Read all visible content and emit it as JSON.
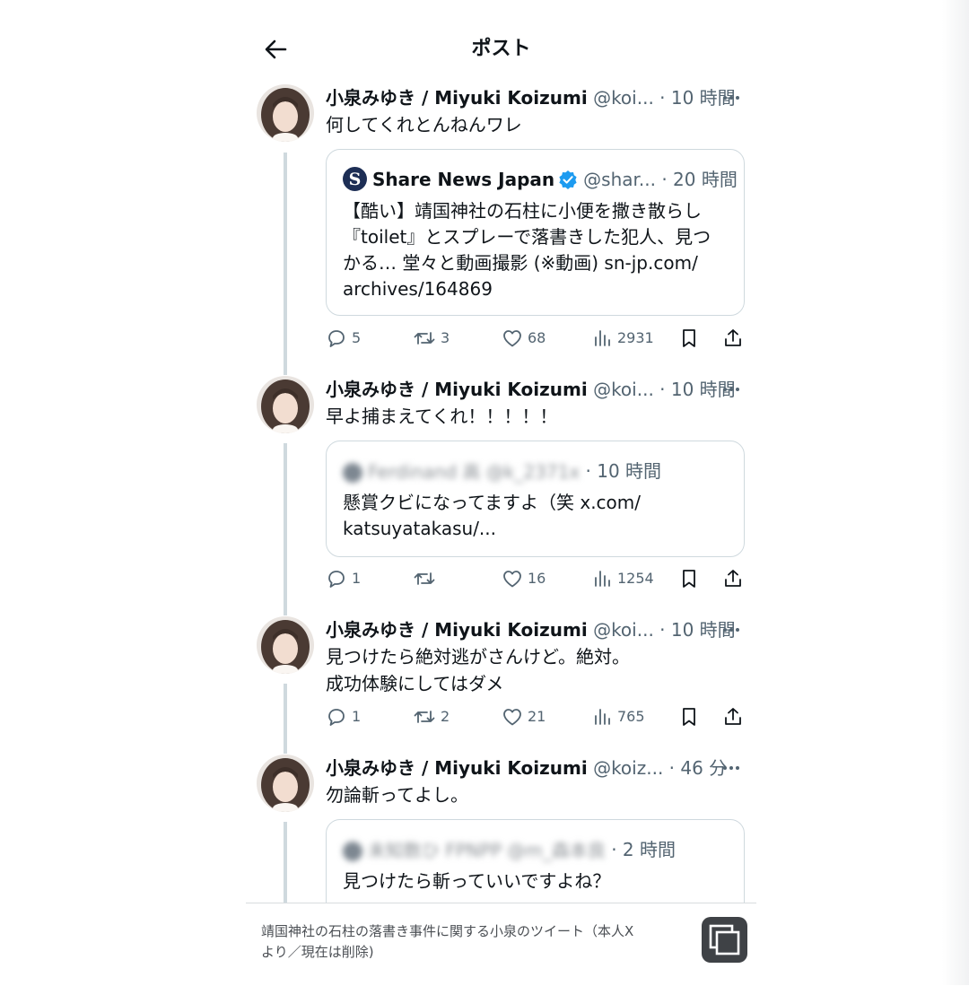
{
  "header": {
    "title": "ポスト"
  },
  "posts": [
    {
      "author": "小泉みゆき / Miyuki Koizumi",
      "handle": "@koi...",
      "time": "· 10 時間",
      "text": "何してくれとんねんワレ",
      "quote": {
        "author": "Share News Japan",
        "handle": "@shar...",
        "time": "· 20 時間",
        "text": "【酷い】靖国神社の石柱に小便を撒き散らし\n『toilet』とスプレーで落書きした犯人、見つ\nかる… 堂々と動画撮影 (※動画) sn-jp.com/\narchives/164869"
      },
      "stats": {
        "replies": "5",
        "reposts": "3",
        "likes": "68",
        "views": "2931"
      }
    },
    {
      "author": "小泉みゆき / Miyuki Koizumi",
      "handle": "@koi...",
      "time": "· 10 時間",
      "text": "早よ捕まえてくれ！！！！！",
      "quote": {
        "author_blurred": "Ferdinand 高 @k_2371x",
        "time": "· 10 時間",
        "text": "懸賞クビになってますよ（笑 x.com/\nkatsuyatakasu/..."
      },
      "stats": {
        "replies": "1",
        "reposts": "",
        "likes": "16",
        "views": "1254"
      }
    },
    {
      "author": "小泉みゆき / Miyuki Koizumi",
      "handle": "@koi...",
      "time": "· 10 時間",
      "text": "見つけたら絶対逃がさんけど。絶対。\n成功体験にしてはダメ",
      "stats": {
        "replies": "1",
        "reposts": "2",
        "likes": "21",
        "views": "765"
      }
    },
    {
      "author": "小泉みゆき / Miyuki Koizumi",
      "handle": "@koiz...",
      "time": "· 46 分",
      "text": "勿論斬ってよし。",
      "quote": {
        "author_blurred": "未知数ひ FPNPP @m_森本良",
        "time": "· 2 時間",
        "text": "見つけたら斬っていいですよね？"
      }
    }
  ],
  "footer": {
    "caption": "靖国神社の石柱の落書き事件に関する小泉のツイート（本人X\nより／現在は削除)"
  },
  "colors": {
    "text": "#0f1419",
    "secondary": "#536471",
    "border": "#cfd9de",
    "verified": "#1d9bf0"
  },
  "icons": [
    "back-arrow-icon",
    "more-icon",
    "reply-icon",
    "repost-icon",
    "like-icon",
    "views-icon",
    "bookmark-icon",
    "share-icon",
    "verified-badge-icon",
    "copy-icon"
  ]
}
